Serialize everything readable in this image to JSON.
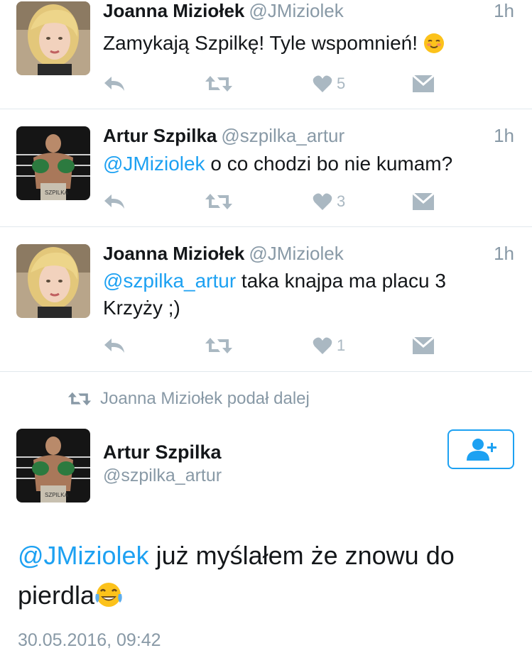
{
  "tweets": [
    {
      "name": "Joanna Miziołek",
      "handle": "@JMiziolek",
      "time": "1h",
      "mention": "",
      "text": "Zamykają Szpilkę! Tyle wspomnień! ",
      "emoji": "relieved-face-emoji",
      "likes": "5"
    },
    {
      "name": "Artur Szpilka",
      "handle": "@szpilka_artur",
      "time": "1h",
      "mention": "@JMiziolek",
      "text": " o co chodzi bo nie kumam?",
      "likes": "3"
    },
    {
      "name": "Joanna Miziołek",
      "handle": "@JMiziolek",
      "time": "1h",
      "mention": "@szpilka_artur",
      "text": " taka knajpa ma placu 3 Krzyży ;)",
      "likes": "1"
    }
  ],
  "retweet_context": "Joanna Miziołek podał dalej",
  "main_tweet": {
    "name": "Artur Szpilka",
    "handle": "@szpilka_artur",
    "mention": "@JMiziolek",
    "text": " już myślałem że znowu do pierdla",
    "emoji": "tears-of-joy-emoji",
    "date": "30.05.2016, 09:42"
  },
  "colors": {
    "accent": "#1da1f2",
    "muted": "#8899a6",
    "icon": "#aab8c2",
    "divider": "#e1e8ed"
  }
}
